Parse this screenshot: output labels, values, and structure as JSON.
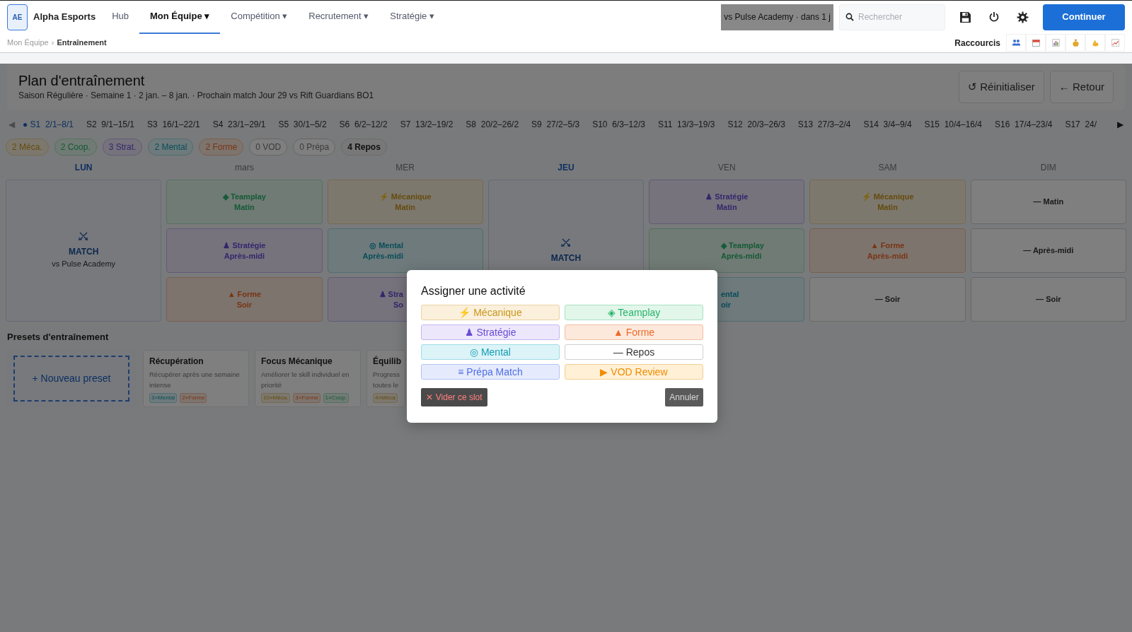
{
  "brand": {
    "logo": "AE",
    "name": "Alpha Esports"
  },
  "nav": [
    {
      "label": "Hub",
      "selected": false
    },
    {
      "label": "Mon Équipe ▾",
      "selected": true
    },
    {
      "label": "Compétition ▾",
      "selected": false
    },
    {
      "label": "Recrutement ▾",
      "selected": false
    },
    {
      "label": "Stratégie ▾",
      "selected": false
    }
  ],
  "next_match": "vs Pulse Academy · dans 1 j",
  "search": {
    "placeholder": "Rechercher"
  },
  "continue_button": "Continuer",
  "breadcrumb": {
    "items": [
      "Mon Équipe",
      "Entraînement"
    ],
    "separator": "›"
  },
  "shortcuts": {
    "label": "Raccourcis"
  },
  "header": {
    "title": "Plan d'entraînement",
    "subtitle": "Saison Régulière · Semaine 1 · 2 jan. – 8 jan. · Prochain match Jour 29 vs Rift Guardians BO1",
    "buttons": [
      "↺ Réinitialiser",
      "← Retour"
    ]
  },
  "weeks": {
    "prev": "◀",
    "next": "▶",
    "items": [
      {
        "label": "● S1  2/1–8/1",
        "selected": true
      },
      {
        "label": "S2  9/1–15/1",
        "selected": false
      },
      {
        "label": "S3  16/1–22/1",
        "selected": false
      },
      {
        "label": "S4  23/1–29/1",
        "selected": false
      },
      {
        "label": "S5  30/1–5/2",
        "selected": false
      },
      {
        "label": "S6  6/2–12/2",
        "selected": false
      },
      {
        "label": "S7  13/2–19/2",
        "selected": false
      },
      {
        "label": "S8  20/2–26/2",
        "selected": false
      },
      {
        "label": "S9  27/2–5/3",
        "selected": false
      },
      {
        "label": "S10  6/3–12/3",
        "selected": false
      },
      {
        "label": "S11  13/3–19/3",
        "selected": false
      },
      {
        "label": "S12  20/3–26/3",
        "selected": false
      },
      {
        "label": "S13  27/3–2/4",
        "selected": false
      },
      {
        "label": "S14  3/4–9/4",
        "selected": false
      },
      {
        "label": "S15  10/4–16/4",
        "selected": false
      },
      {
        "label": "S16  17/4–23/4",
        "selected": false
      },
      {
        "label": "S17  24/",
        "selected": false
      }
    ]
  },
  "counts": [
    {
      "text": "2 Méca.",
      "kind": "mecanique"
    },
    {
      "text": "2 Coop.",
      "kind": "teamplay"
    },
    {
      "text": "3 Strat.",
      "kind": "strategie"
    },
    {
      "text": "2 Mental",
      "kind": "mental"
    },
    {
      "text": "2 Forme",
      "kind": "forme"
    },
    {
      "text": "0 VOD",
      "kind": "empty"
    },
    {
      "text": "0 Prépa",
      "kind": "empty"
    },
    {
      "text": "4 Repos",
      "kind": "rest"
    }
  ],
  "days": [
    {
      "label": "LUN",
      "kind": "match",
      "match": {
        "title": "MATCH",
        "opponent": "vs Pulse Academy"
      }
    },
    {
      "label": "mars",
      "kind": "slots",
      "slots": [
        {
          "kind": "teamplay",
          "label": "◈ Teamplay",
          "period": "Matin"
        },
        {
          "kind": "strategie",
          "label": "♟ Stratégie",
          "period": "Après-midi"
        },
        {
          "kind": "forme",
          "label": "▲ Forme",
          "period": "Soir"
        }
      ]
    },
    {
      "label": "MER",
      "kind": "slots",
      "slots": [
        {
          "kind": "mecanique",
          "label": "⚡ Mécanique",
          "period": "Matin"
        },
        {
          "kind": "mental",
          "label": "◎ Mental",
          "period": "Après-midi"
        },
        {
          "kind": "strategie",
          "label": "♟ Stra",
          "period": "So"
        }
      ]
    },
    {
      "label": "JEU",
      "kind": "match",
      "match": {
        "title": "MATCH"
      }
    },
    {
      "label": "VEN",
      "kind": "slots",
      "slots": [
        {
          "kind": "strategie",
          "label": "♟ Stratégie",
          "period": "Matin"
        },
        {
          "kind": "teamplay",
          "label": "◈ Teamplay",
          "period": "Après-midi"
        },
        {
          "kind": "mental",
          "label": "ental",
          "period": "oir"
        }
      ]
    },
    {
      "label": "SAM",
      "kind": "slots",
      "slots": [
        {
          "kind": "mecanique",
          "label": "⚡ Mécanique",
          "period": "Matin"
        },
        {
          "kind": "forme",
          "label": "▲ Forme",
          "period": "Après-midi"
        },
        {
          "kind": "repos",
          "label": "— Soir"
        }
      ]
    },
    {
      "label": "DIM",
      "kind": "slots",
      "slots": [
        {
          "kind": "repos",
          "label": "— Matin"
        },
        {
          "kind": "repos",
          "label": "— Après-midi"
        },
        {
          "kind": "repos",
          "label": "— Soir"
        }
      ]
    }
  ],
  "presets": {
    "title": "Presets d'entraînement",
    "new_button": "+ Nouveau preset",
    "items": [
      {
        "title": "Récupération",
        "description": "Récupérer après une semaine intense",
        "tags": [
          {
            "text": "3×Mental",
            "kind": "mental"
          },
          {
            "text": "2×Forme",
            "kind": "forme"
          }
        ]
      },
      {
        "title": "Focus Mécanique",
        "description": "Améliorer le skill individuel en priorité",
        "tags": [
          {
            "text": "10×Méca.",
            "kind": "mecanique"
          },
          {
            "text": "3×Forme",
            "kind": "forme"
          },
          {
            "text": "1×Coop.",
            "kind": "teamplay"
          }
        ]
      },
      {
        "title": "Équilib",
        "description": "Progress toutes le",
        "tags": [
          {
            "text": "4×Méca",
            "kind": "mecanique"
          }
        ]
      }
    ]
  },
  "modal": {
    "title": "Assigner une activité",
    "options": [
      {
        "kind": "mecanique",
        "label": "⚡ Mécanique"
      },
      {
        "kind": "teamplay",
        "label": "◈ Teamplay"
      },
      {
        "kind": "strategie",
        "label": "♟ Stratégie"
      },
      {
        "kind": "forme",
        "label": "▲ Forme"
      },
      {
        "kind": "mental",
        "label": "◎ Mental"
      },
      {
        "kind": "repos",
        "label": "— Repos"
      },
      {
        "kind": "prepa",
        "label": "≡ Prépa Match"
      },
      {
        "kind": "vod",
        "label": "▶ VOD Review"
      }
    ],
    "clear_button": "✕ Vider ce slot",
    "cancel_button": "Annuler"
  }
}
